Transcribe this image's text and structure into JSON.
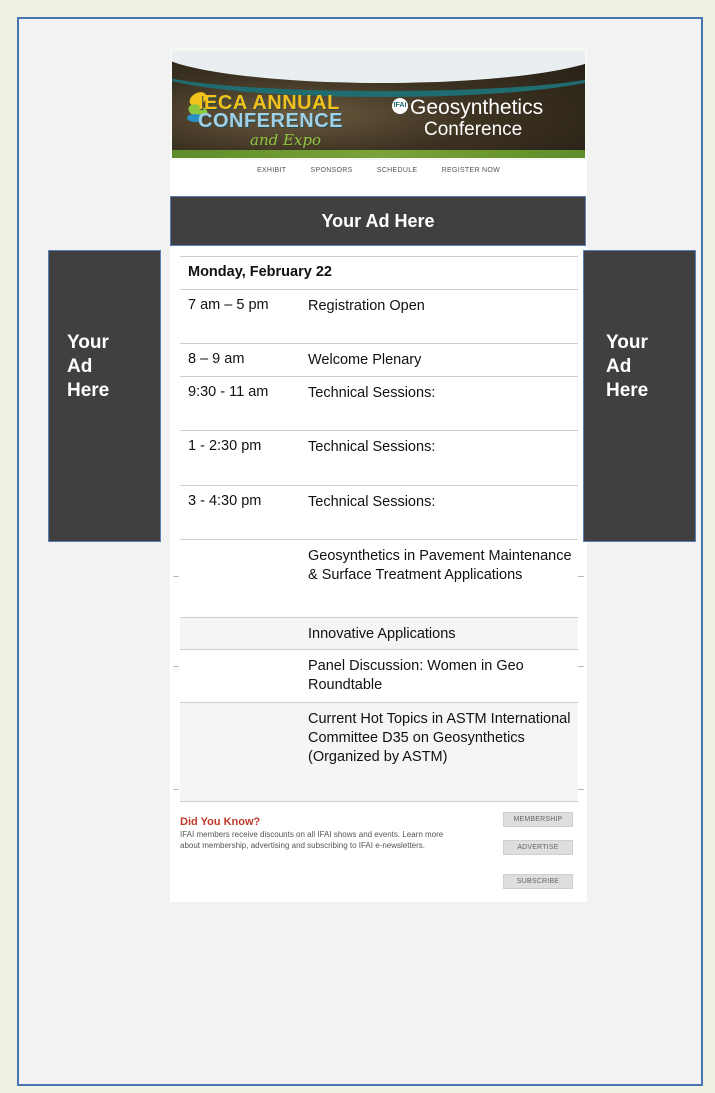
{
  "banner": {
    "ieca_line1": "IECA ANNUAL",
    "ieca_line2": "CONFERENCE",
    "ieca_expo": "and Expo",
    "ifai_logo": "IFAI",
    "geo_title": "Geosynthetics",
    "geo_sub": "Conference"
  },
  "nav": {
    "items": [
      "EXHIBIT",
      "SPONSORS",
      "SCHEDULE",
      "REGISTER NOW"
    ]
  },
  "ads": {
    "top": "Your Ad Here",
    "left_lines": [
      "Your",
      "Ad",
      "Here"
    ],
    "right_lines": [
      "Your",
      "Ad",
      "Here"
    ],
    "color": "#404040",
    "border_color": "#5b7fb4"
  },
  "schedule": {
    "day": "Monday, February 22",
    "rows": [
      {
        "time": "7 am – 5 pm",
        "event": "Registration Open"
      },
      {
        "time": "8 – 9 am",
        "event": "Welcome Plenary"
      },
      {
        "time": "9:30 - 11 am",
        "event": "Technical Sessions:"
      },
      {
        "time": "1 - 2:30 pm",
        "event": "Technical Sessions:"
      },
      {
        "time": "3 - 4:30 pm",
        "event": "Technical Sessions:"
      },
      {
        "time": "",
        "event": "Geosynthetics in Pavement Maintenance & Surface Treatment Applications"
      },
      {
        "time": "",
        "event": "Innovative Applications"
      },
      {
        "time": "",
        "event": "Panel Discussion: Women in Geo Roundtable"
      },
      {
        "time": "",
        "event": "Current Hot Topics in ASTM International Committee D35 on Geosynthetics (Organized by ASTM)"
      }
    ]
  },
  "footer": {
    "title": "Did You Know?",
    "text": "IFAI members receive discounts on all IFAI shows and events. Learn more about membership, advertising and subscribing to IFAI e-newsletters.",
    "buttons": [
      "MEMBERSHIP",
      "ADVERTISE",
      "SUBSCRIBE"
    ],
    "title_color": "#c0392b"
  }
}
